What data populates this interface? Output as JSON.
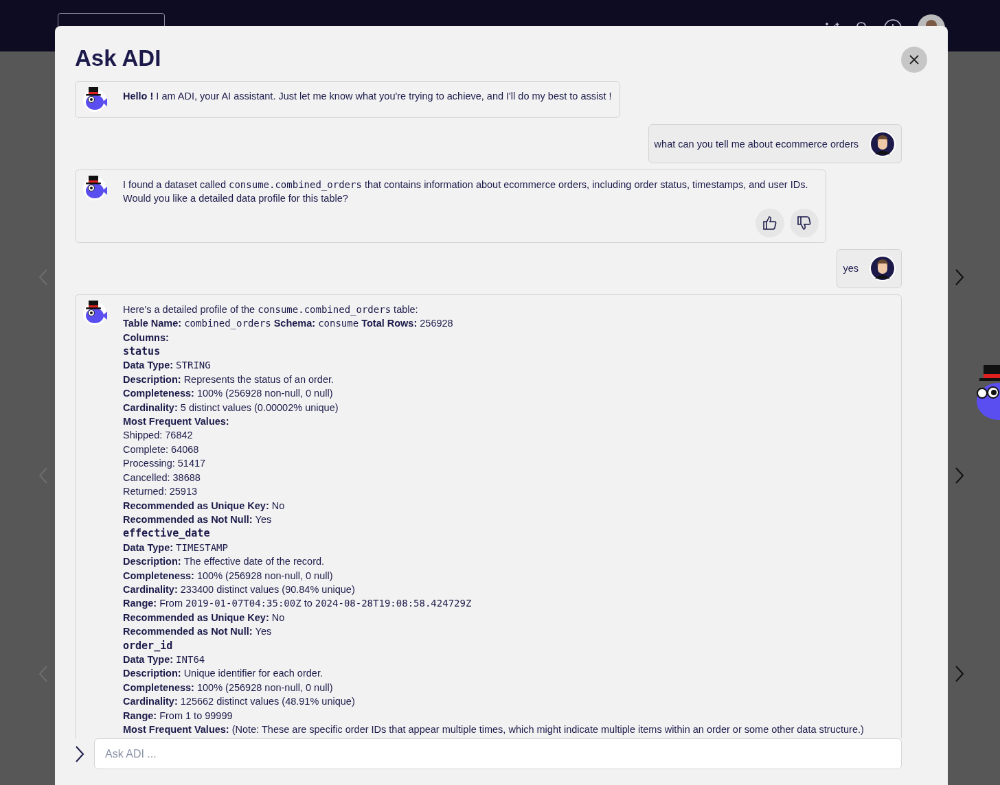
{
  "dialog": {
    "title": "Ask ADI",
    "messages": [
      {
        "kind": "bot",
        "feedback": false,
        "lines": [
          [
            {
              "kind": "b",
              "text": "Hello !"
            },
            {
              "kind": "t",
              "text": " I am ADI, your AI assistant. Just let me know what you're trying to achieve, and I'll do my best to assist !"
            }
          ]
        ]
      },
      {
        "kind": "user",
        "text": "what can you tell me about ecommerce orders"
      },
      {
        "kind": "bot",
        "feedback": true,
        "lines": [
          [
            {
              "kind": "t",
              "text": "I found a dataset called "
            },
            {
              "kind": "c",
              "text": "consume.combined_orders"
            },
            {
              "kind": "t",
              "text": " that contains information about ecommerce orders, including order status, timestamps, and user IDs."
            }
          ],
          [
            {
              "kind": "t",
              "text": "Would you like a detailed data profile for this table?"
            }
          ]
        ]
      },
      {
        "kind": "user",
        "text": "yes"
      },
      {
        "kind": "bot",
        "feedback": false,
        "lines": [
          [
            {
              "kind": "t",
              "text": "Here's a detailed profile of the "
            },
            {
              "kind": "c",
              "text": "consume.combined_orders"
            },
            {
              "kind": "t",
              "text": " table:"
            }
          ],
          [
            {
              "kind": "b",
              "text": "Table Name: "
            },
            {
              "kind": "c",
              "text": "combined_orders"
            },
            {
              "kind": "b",
              "text": " Schema: "
            },
            {
              "kind": "c",
              "text": "consume"
            },
            {
              "kind": "b",
              "text": " Total Rows: "
            },
            {
              "kind": "t",
              "text": "256928"
            }
          ],
          [
            {
              "kind": "b",
              "text": "Columns:"
            }
          ],
          [
            {
              "kind": "col",
              "text": "status"
            }
          ],
          [
            {
              "kind": "b",
              "text": "Data Type: "
            },
            {
              "kind": "c",
              "text": "STRING"
            }
          ],
          [
            {
              "kind": "b",
              "text": "Description: "
            },
            {
              "kind": "t",
              "text": "Represents the status of an order."
            }
          ],
          [
            {
              "kind": "b",
              "text": "Completeness: "
            },
            {
              "kind": "t",
              "text": "100% (256928 non-null, 0 null)"
            }
          ],
          [
            {
              "kind": "b",
              "text": "Cardinality: "
            },
            {
              "kind": "t",
              "text": "5 distinct values (0.00002% unique)"
            }
          ],
          [
            {
              "kind": "b",
              "text": "Most Frequent Values:"
            }
          ],
          [
            {
              "kind": "t",
              "text": "Shipped: 76842"
            }
          ],
          [
            {
              "kind": "t",
              "text": "Complete: 64068"
            }
          ],
          [
            {
              "kind": "t",
              "text": "Processing: 51417"
            }
          ],
          [
            {
              "kind": "t",
              "text": "Cancelled: 38688"
            }
          ],
          [
            {
              "kind": "t",
              "text": "Returned: 25913"
            }
          ],
          [
            {
              "kind": "b",
              "text": "Recommended as Unique Key: "
            },
            {
              "kind": "t",
              "text": "No"
            }
          ],
          [
            {
              "kind": "b",
              "text": "Recommended as Not Null: "
            },
            {
              "kind": "t",
              "text": "Yes"
            }
          ],
          [
            {
              "kind": "col",
              "text": "effective_date"
            }
          ],
          [
            {
              "kind": "b",
              "text": "Data Type: "
            },
            {
              "kind": "c",
              "text": "TIMESTAMP"
            }
          ],
          [
            {
              "kind": "b",
              "text": "Description: "
            },
            {
              "kind": "t",
              "text": "The effective date of the record."
            }
          ],
          [
            {
              "kind": "b",
              "text": "Completeness: "
            },
            {
              "kind": "t",
              "text": "100% (256928 non-null, 0 null)"
            }
          ],
          [
            {
              "kind": "b",
              "text": "Cardinality: "
            },
            {
              "kind": "t",
              "text": "233400 distinct values (90.84% unique)"
            }
          ],
          [
            {
              "kind": "b",
              "text": "Range: "
            },
            {
              "kind": "t",
              "text": "From "
            },
            {
              "kind": "c",
              "text": "2019-01-07T04:35:00Z"
            },
            {
              "kind": "t",
              "text": " to "
            },
            {
              "kind": "c",
              "text": "2024-08-28T19:08:58.424729Z"
            }
          ],
          [
            {
              "kind": "b",
              "text": "Recommended as Unique Key: "
            },
            {
              "kind": "t",
              "text": "No"
            }
          ],
          [
            {
              "kind": "b",
              "text": "Recommended as Not Null: "
            },
            {
              "kind": "t",
              "text": "Yes"
            }
          ],
          [
            {
              "kind": "col",
              "text": "order_id"
            }
          ],
          [
            {
              "kind": "b",
              "text": "Data Type: "
            },
            {
              "kind": "c",
              "text": "INT64"
            }
          ],
          [
            {
              "kind": "b",
              "text": "Description: "
            },
            {
              "kind": "t",
              "text": "Unique identifier for each order."
            }
          ],
          [
            {
              "kind": "b",
              "text": "Completeness: "
            },
            {
              "kind": "t",
              "text": "100% (256928 non-null, 0 null)"
            }
          ],
          [
            {
              "kind": "b",
              "text": "Cardinality: "
            },
            {
              "kind": "t",
              "text": "125662 distinct values (48.91% unique)"
            }
          ],
          [
            {
              "kind": "b",
              "text": "Range: "
            },
            {
              "kind": "t",
              "text": "From 1 to 99999"
            }
          ],
          [
            {
              "kind": "b",
              "text": "Most Frequent Values: "
            },
            {
              "kind": "t",
              "text": "(Note: These are specific order IDs that appear multiple times, which might indicate multiple items within an order or some other data structure.)"
            }
          ]
        ]
      }
    ],
    "input": {
      "placeholder": "Ask ADI ..."
    }
  }
}
